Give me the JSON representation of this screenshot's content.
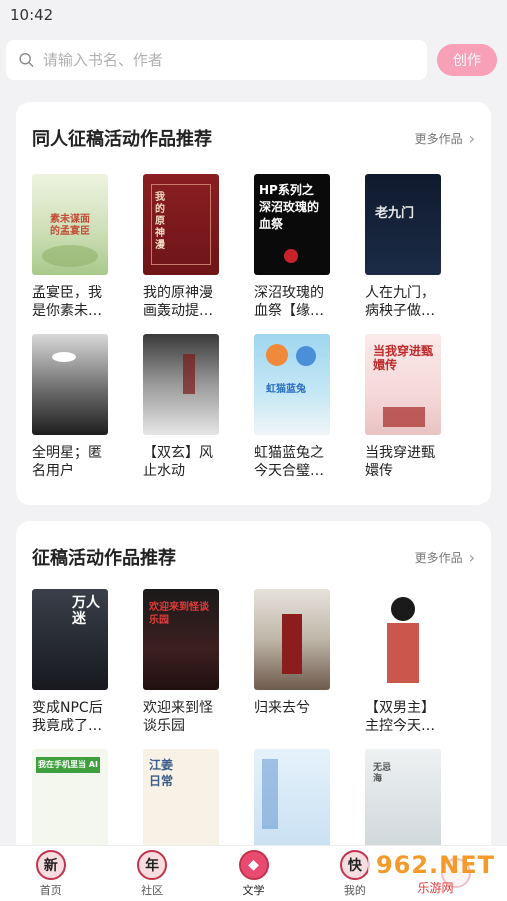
{
  "status_bar": {
    "time": "10:42"
  },
  "search": {
    "placeholder": "请输入书名、作者",
    "create_label": "创作"
  },
  "section1": {
    "title": "同人征稿活动作品推荐",
    "more_label": "更多作品",
    "books": [
      {
        "title": "孟宴臣，我是你素未…",
        "cover_text": "素未谋面的孟宴臣"
      },
      {
        "title": "我的原神漫画轰动提…",
        "cover_text": "我的原神漫"
      },
      {
        "title": "深沼玫瑰的血祭【缘…",
        "cover_text": "HP系列之 深沼玫瑰的血祭"
      },
      {
        "title": "人在九门，病秧子做…",
        "cover_text": "老九门"
      },
      {
        "title": "全明星；匿名用户",
        "cover_text": ""
      },
      {
        "title": "【双玄】风止水动",
        "cover_text": ""
      },
      {
        "title": "虹猫蓝兔之今天合璧…",
        "cover_text": "虹猫蓝兔"
      },
      {
        "title": "当我穿进甄嬛传",
        "cover_text": "当我穿进甄嬛传"
      }
    ]
  },
  "section2": {
    "title": "征稿活动作品推荐",
    "more_label": "更多作品",
    "books": [
      {
        "title": "变成NPC后我竟成了…",
        "cover_text": "万人迷"
      },
      {
        "title": "欢迎来到怪谈乐园",
        "cover_text": "欢迎来到怪谈乐园"
      },
      {
        "title": "归来去兮",
        "cover_text": ""
      },
      {
        "title": "【双男主】主控今天…",
        "cover_text": ""
      },
      {
        "title": "",
        "cover_text": "我在手机里当 AI"
      },
      {
        "title": "",
        "cover_text": "江姜日常"
      },
      {
        "title": "",
        "cover_text": ""
      },
      {
        "title": "",
        "cover_text": "无忌海"
      }
    ]
  },
  "tabbar": [
    {
      "label": "首页",
      "icon_char": "新"
    },
    {
      "label": "社区",
      "icon_char": "年"
    },
    {
      "label": "文学",
      "icon_char": ""
    },
    {
      "label": "我的",
      "icon_char": "快"
    },
    {
      "label": "",
      "icon_char": ""
    }
  ],
  "watermark": {
    "logo": "962.NET",
    "sub": "乐游网"
  },
  "colors": {
    "accent": "#f7a0b8",
    "tab_accent": "#e94a6f",
    "watermark": "#f39a2b"
  }
}
